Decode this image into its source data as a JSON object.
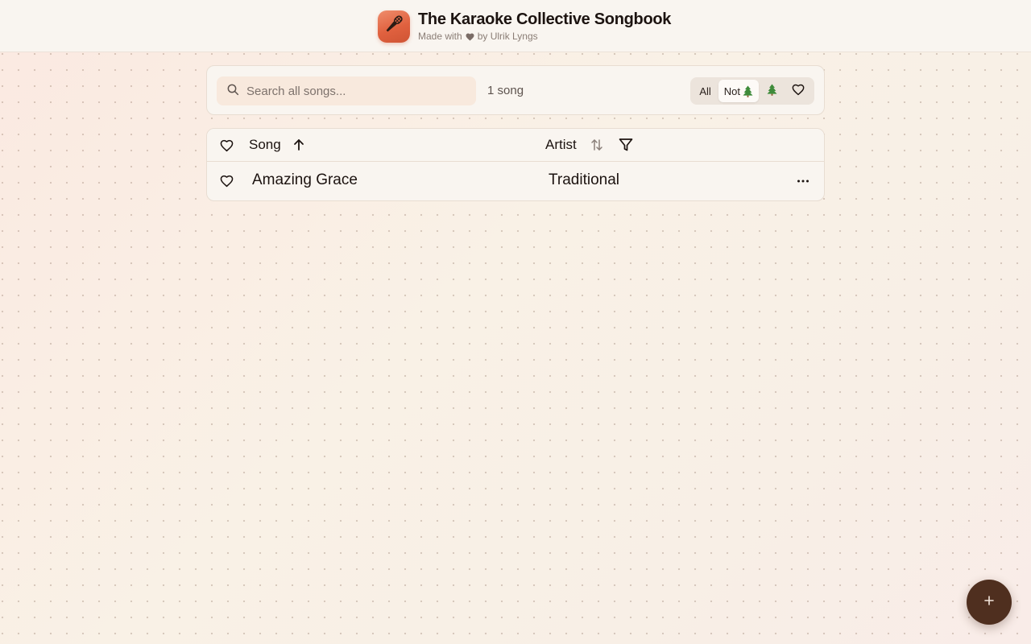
{
  "app": {
    "title": "The Karaoke Collective Songbook",
    "credit_prefix": "Made with",
    "credit_suffix": "by Ulrik Lyngs",
    "logo_icon": "microphone-icon",
    "accent_color": "#e0613f"
  },
  "toolbar": {
    "search_placeholder": "Search all songs...",
    "search_value": "",
    "song_count": "1 song",
    "filters": [
      {
        "label": "All",
        "icon": null,
        "active": false
      },
      {
        "label": "Not",
        "icon": "christmas-tree-icon",
        "active": true
      },
      {
        "label": "",
        "icon": "christmas-tree-icon",
        "active": false
      },
      {
        "label": "",
        "icon": "heart-icon",
        "active": false
      }
    ]
  },
  "table": {
    "columns": {
      "favorite_icon": "heart-icon",
      "song": "Song",
      "song_sort": "ascending",
      "artist": "Artist",
      "artist_sort": "none"
    },
    "rows": [
      {
        "song": "Amazing Grace",
        "artist": "Traditional",
        "favorite": false
      }
    ]
  },
  "fab": {
    "icon": "plus-icon",
    "color": "#4f2f1f"
  }
}
